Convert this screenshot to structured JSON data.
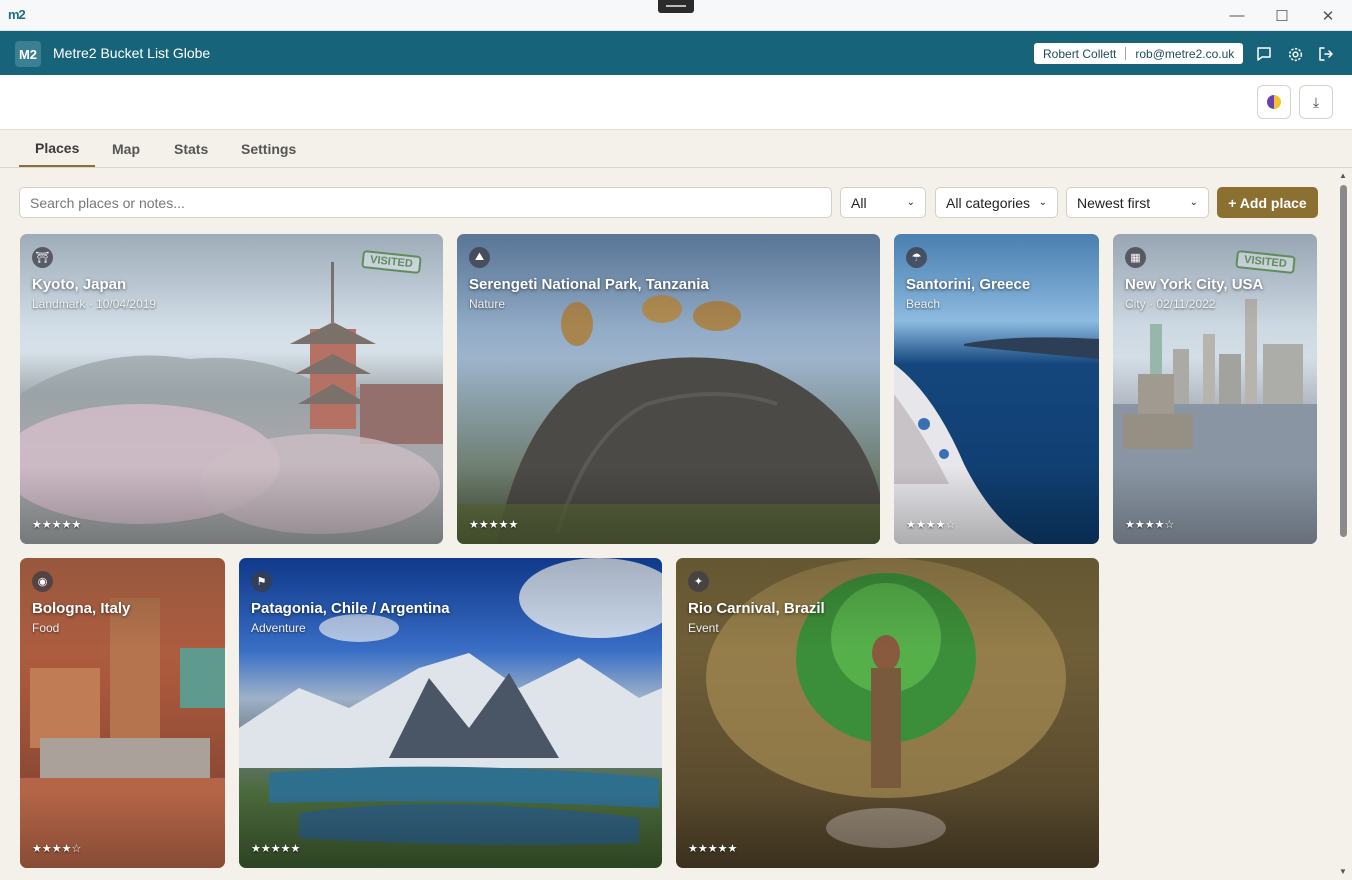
{
  "window": {
    "logo": "m2",
    "minimize": "—",
    "maximize": "☐",
    "close": "✕"
  },
  "header": {
    "badge": "M2",
    "title": "Metre2 Bucket List Globe",
    "user_name": "Robert Collett",
    "user_email": "rob@metre2.co.uk",
    "icons": [
      "chat-icon",
      "gear-icon",
      "logout-icon"
    ]
  },
  "toolbar": {
    "theme_icon": "theme-toggle-icon",
    "download_label": "⤓"
  },
  "tabs": [
    {
      "label": "Places",
      "active": true
    },
    {
      "label": "Map",
      "active": false
    },
    {
      "label": "Stats",
      "active": false
    },
    {
      "label": "Settings",
      "active": false
    }
  ],
  "filters": {
    "search_placeholder": "Search places or notes...",
    "status": "All",
    "category": "All categories",
    "sort": "Newest first",
    "add_label": "+ Add place"
  },
  "places": [
    {
      "title": "Kyoto, Japan",
      "subtitle": "Landmark · 10/04/2019",
      "category": "Landmark",
      "stars": "★★★★★",
      "rating": 5,
      "visited": true,
      "stamp": "VISITED"
    },
    {
      "title": "Serengeti National Park, Tanzania",
      "subtitle": "Nature",
      "category": "Nature",
      "stars": "★★★★★",
      "rating": 5,
      "visited": false
    },
    {
      "title": "Santorini, Greece",
      "subtitle": "Beach",
      "category": "Beach",
      "stars": "★★★★☆",
      "rating": 4,
      "visited": false
    },
    {
      "title": "New York City, USA",
      "subtitle": "City · 02/11/2022",
      "category": "City",
      "stars": "★★★★☆",
      "rating": 4,
      "visited": true,
      "stamp": "VISITED"
    },
    {
      "title": "Bologna, Italy",
      "subtitle": "Food",
      "category": "Food",
      "stars": "★★★★☆",
      "rating": 4,
      "visited": false
    },
    {
      "title": "Patagonia, Chile / Argentina",
      "subtitle": "Adventure",
      "category": "Adventure",
      "stars": "★★★★★",
      "rating": 5,
      "visited": false
    },
    {
      "title": "Rio Carnival, Brazil",
      "subtitle": "Event",
      "category": "Event",
      "stars": "★★★★★",
      "rating": 5,
      "visited": false
    }
  ],
  "colors": {
    "header": "#17647a",
    "accent": "#8c7032",
    "background": "#f4f1eb",
    "visited_stamp": "#5f8e5c"
  }
}
